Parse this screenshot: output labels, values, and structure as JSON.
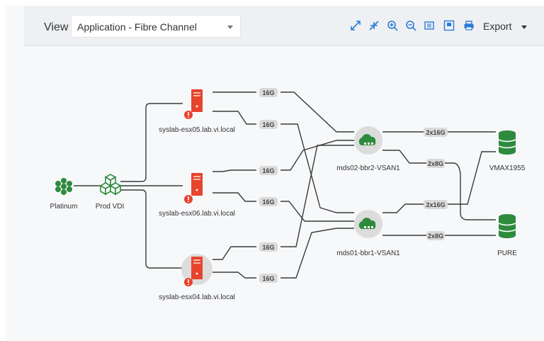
{
  "toolbar": {
    "view_label": "View",
    "view_value": "Application - Fibre Channel",
    "tools": [
      "expand-icon",
      "collapse-icon",
      "zoom-in-icon",
      "zoom-out-icon",
      "fit-icon",
      "window-icon",
      "print-icon"
    ],
    "export_label": "Export"
  },
  "nodes": {
    "platinum": "Platinum",
    "prod_vdi": "Prod VDI",
    "host1": "syslab-esx05.lab.vi.local",
    "host2": "syslab-esx06.lab.vi.local",
    "host3": "syslab-esx04.lab.vi.local",
    "switch1": "mds02-bbr2-VSAN1",
    "switch2": "mds01-bbr1-VSAN1",
    "storage1": "VMAX1955",
    "storage2": "PURE"
  },
  "links": {
    "l1": "16G",
    "l2": "16G",
    "l3": "16G",
    "l4": "16G",
    "l5": "16G",
    "l6": "16G",
    "s1": "2x16G",
    "s2": "2x8G",
    "s3": "2x16G",
    "s4": "2x8G"
  },
  "colors": {
    "host_red": "#e8432b",
    "node_green": "#2e8b3e",
    "line": "#3a3a3a"
  }
}
